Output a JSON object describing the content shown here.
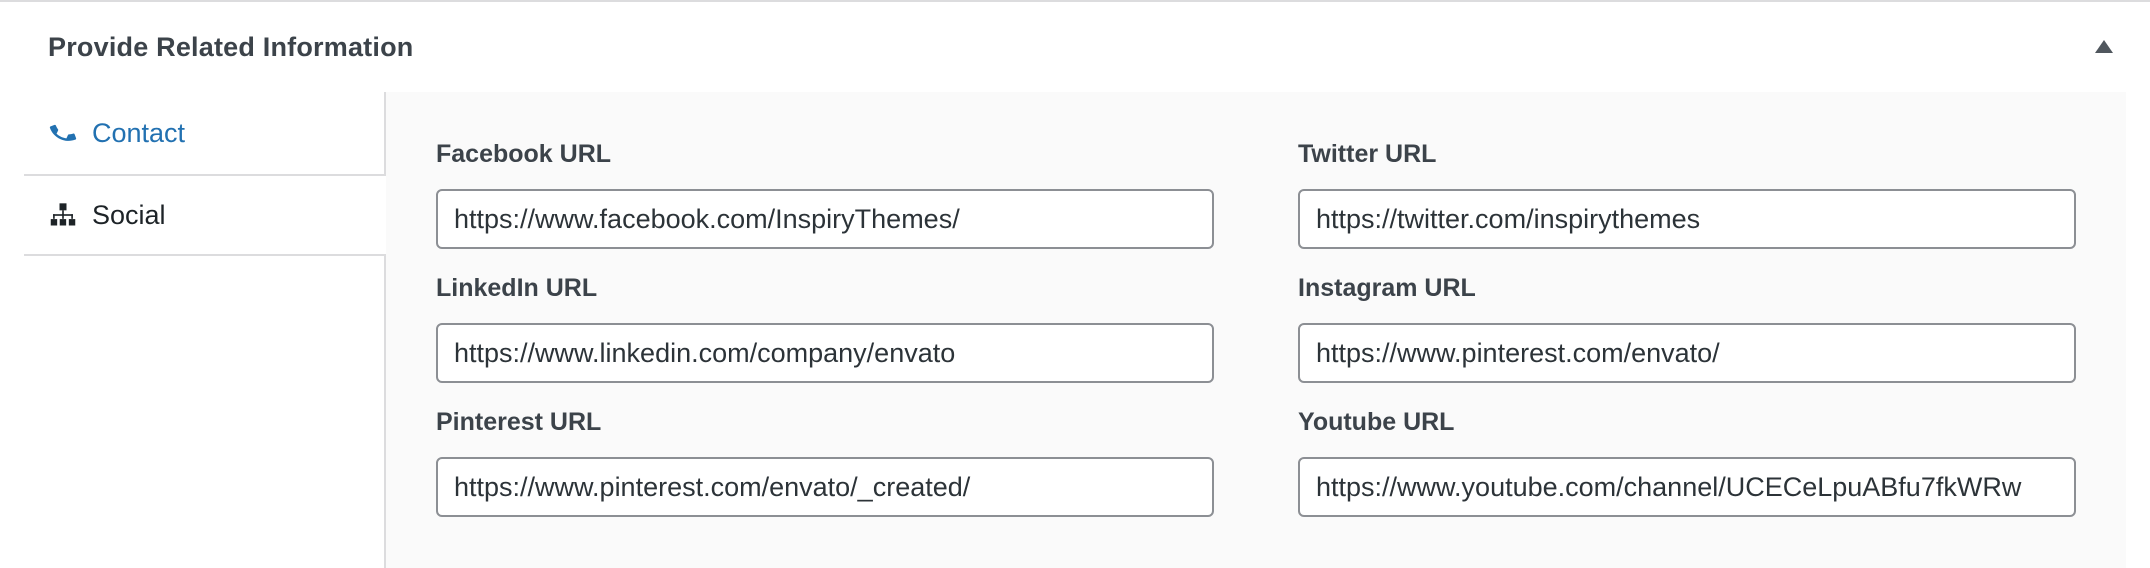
{
  "metabox": {
    "title": "Provide Related Information"
  },
  "tabs": [
    {
      "label": "Contact",
      "icon": "phone-icon"
    },
    {
      "label": "Social",
      "icon": "sitemap-icon"
    }
  ],
  "fields": {
    "facebook": {
      "label": "Facebook URL",
      "value": "https://www.facebook.com/InspiryThemes/"
    },
    "twitter": {
      "label": "Twitter URL",
      "value": "https://twitter.com/inspirythemes"
    },
    "linkedin": {
      "label": "LinkedIn URL",
      "value": "https://www.linkedin.com/company/envato"
    },
    "instagram": {
      "label": "Instagram URL",
      "value": "https://www.pinterest.com/envato/"
    },
    "pinterest": {
      "label": "Pinterest URL",
      "value": "https://www.pinterest.com/envato/_created/"
    },
    "youtube": {
      "label": "Youtube URL",
      "value": "https://www.youtube.com/channel/UCECeLpuABfu7fkWRw"
    }
  },
  "colors": {
    "active_tab": "#2271b1",
    "border": "#dcdcde",
    "input_border": "#8c8f94"
  }
}
